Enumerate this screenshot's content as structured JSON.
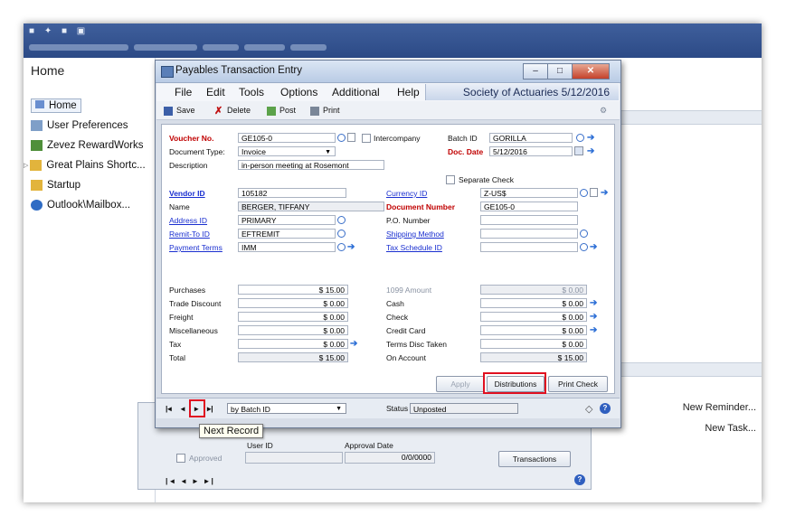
{
  "home": {
    "title": "Home",
    "nav": [
      "Home",
      "User Preferences",
      "Zevez RewardWorks",
      "Great Plains Shortc...",
      "Startup",
      "Outlook\\Mailbox..."
    ]
  },
  "right_links": [
    "New Reminder...",
    "New Task..."
  ],
  "window": {
    "title": "Payables Transaction Entry",
    "menu": [
      "File",
      "Edit",
      "Tools",
      "Options",
      "Additional",
      "Help"
    ],
    "company": "Society of Actuaries  5/12/2016",
    "toolbar": {
      "save": "Save",
      "delete": "Delete",
      "post": "Post",
      "print": "Print"
    },
    "form": {
      "voucher_label": "Voucher No.",
      "voucher": "GE105-0",
      "intercompany_label": "Intercompany",
      "batch_label": "Batch ID",
      "batch": "GORILLA",
      "doctype_label": "Document Type:",
      "doctype": "Invoice",
      "docdate_label": "Doc. Date",
      "docdate": "5/12/2016",
      "description_label": "Description",
      "description": "in-person meeting at Rosemont",
      "separate_check_label": "Separate Check",
      "vendor_label": "Vendor ID",
      "vendor": "105182",
      "currency_label": "Currency ID",
      "currency": "Z-US$",
      "name_label": "Name",
      "name": "BERGER, TIFFANY",
      "docnum_label": "Document Number",
      "docnum": "GE105-0",
      "address_label": "Address ID",
      "address": "PRIMARY",
      "po_label": "P.O. Number",
      "po": "",
      "remit_label": "Remit-To ID",
      "remit": "EFTREMIT",
      "shipping_label": "Shipping Method",
      "shipping": "",
      "terms_label": "Payment Terms",
      "terms": "IMM",
      "taxsched_label": "Tax Schedule ID",
      "taxsched": ""
    },
    "amounts_left": [
      {
        "label": "Purchases",
        "value": "$ 15.00"
      },
      {
        "label": "Trade Discount",
        "value": "$ 0.00"
      },
      {
        "label": "Freight",
        "value": "$ 0.00"
      },
      {
        "label": "Miscellaneous",
        "value": "$ 0.00"
      },
      {
        "label": "Tax",
        "value": "$ 0.00"
      },
      {
        "label": "Total",
        "value": "$ 15.00"
      }
    ],
    "amounts_right": [
      {
        "label": "1099 Amount",
        "value": "$ 0.00"
      },
      {
        "label": "Cash",
        "value": "$ 0.00"
      },
      {
        "label": "Check",
        "value": "$ 0.00"
      },
      {
        "label": "Credit Card",
        "value": "$ 0.00"
      },
      {
        "label": "Terms Disc Taken",
        "value": "$ 0.00"
      },
      {
        "label": "On Account",
        "value": "$ 15.00"
      }
    ],
    "buttons": {
      "apply": "Apply",
      "distributions": "Distributions",
      "print_check": "Print Check"
    },
    "status_bar": {
      "sort": "by Batch ID",
      "status_label": "Status",
      "status": "Unposted"
    }
  },
  "tooltip": "Next Record",
  "behind": {
    "user_id": "User ID",
    "approval_date": "Approval Date",
    "approved": "Approved",
    "date": "0/0/0000",
    "transactions": "Transactions"
  }
}
